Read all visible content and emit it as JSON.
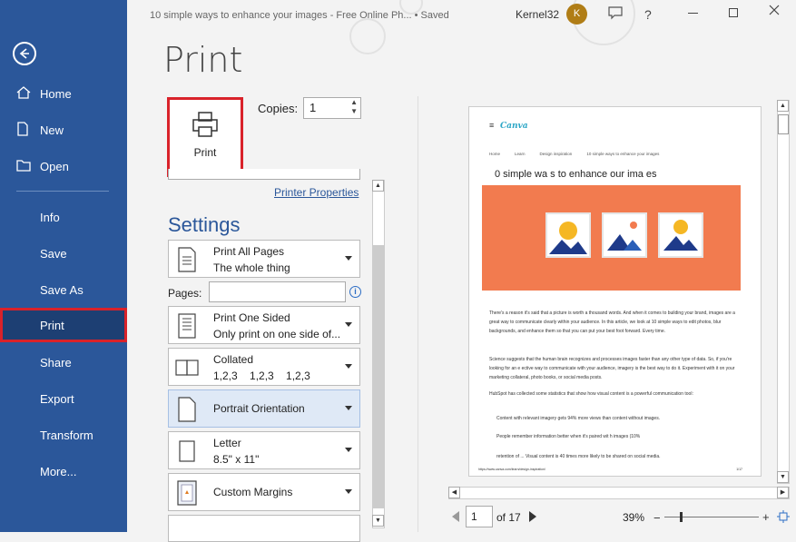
{
  "titlebar": {
    "document_title": "10 simple ways to enhance your images - Free Online Ph... • Saved",
    "user_name": "Kernel32",
    "avatar_letter": "K",
    "help": "?"
  },
  "sidebar": {
    "items": [
      {
        "label": "Home",
        "icon": "home-icon"
      },
      {
        "label": "New",
        "icon": "new-document-icon"
      },
      {
        "label": "Open",
        "icon": "folder-icon"
      },
      {
        "label": "Info"
      },
      {
        "label": "Save"
      },
      {
        "label": "Save As"
      },
      {
        "label": "Print",
        "selected": true
      },
      {
        "label": "Share"
      },
      {
        "label": "Export"
      },
      {
        "label": "Transform"
      },
      {
        "label": "More..."
      }
    ]
  },
  "print": {
    "page_title": "Print",
    "print_button": "Print",
    "copies_label": "Copies:",
    "copies_value": "1",
    "printer_properties": "Printer Properties",
    "settings_heading": "Settings",
    "pages_label": "Pages:",
    "pages_value": "",
    "options": [
      {
        "title": "Print All Pages",
        "subtitle": "The whole thing"
      },
      {
        "title": "Print One Sided",
        "subtitle": "Only print on one side of..."
      },
      {
        "title": "Collated",
        "subtitle": "1,2,3    1,2,3    1,2,3"
      },
      {
        "title": "Portrait Orientation",
        "subtitle": ""
      },
      {
        "title": "Letter",
        "subtitle": "8.5\" x 11\""
      },
      {
        "title": "Custom Margins",
        "subtitle": ""
      }
    ]
  },
  "preview": {
    "brand": "Canva",
    "breadcrumb": [
      "Home",
      "Learn",
      "Design inspiration",
      "10 simple ways to enhance your images"
    ],
    "heading": "0 simple wa s to enhance our ima es",
    "p1": "There's a reason it's said that a picture is worth a thousand words. And when it comes to building your brand, images are a great way to communicate clearly within your audience. In this article, we look at 10 simple ways to edit photos, blur backgrounds, and enhance them so that you can put your best foot forward. Every time.",
    "p2": "Science suggests that the human brain recognizes and processes images faster than any other type of data. So, if you're looking for an e     ective way to communicate with your audience, imagery is the best way to do it. Experiment with it on your marketing collateral, photo books, or social media posts.",
    "p3": "HubSpot has collected some statistics that show how visual content is a powerful communication tool:",
    "b1": "Content with relevant imagery gets 94% more views than content without images.",
    "b2": "People remember information better when it's paired wit                              h images (10%",
    "b3": "retention of ... Visual content is 40 times more likely to be shared on social media.",
    "footer_url": "https://www.canva.com/learn/design-inspiration/",
    "footer_page": "1/17"
  },
  "bottom": {
    "current_page": "1",
    "of_pages": "of 17",
    "zoom": "39%"
  },
  "colors": {
    "sidebar": "#2b579a",
    "selected_outline": "#d9222a",
    "hero": "#f27b4f"
  }
}
